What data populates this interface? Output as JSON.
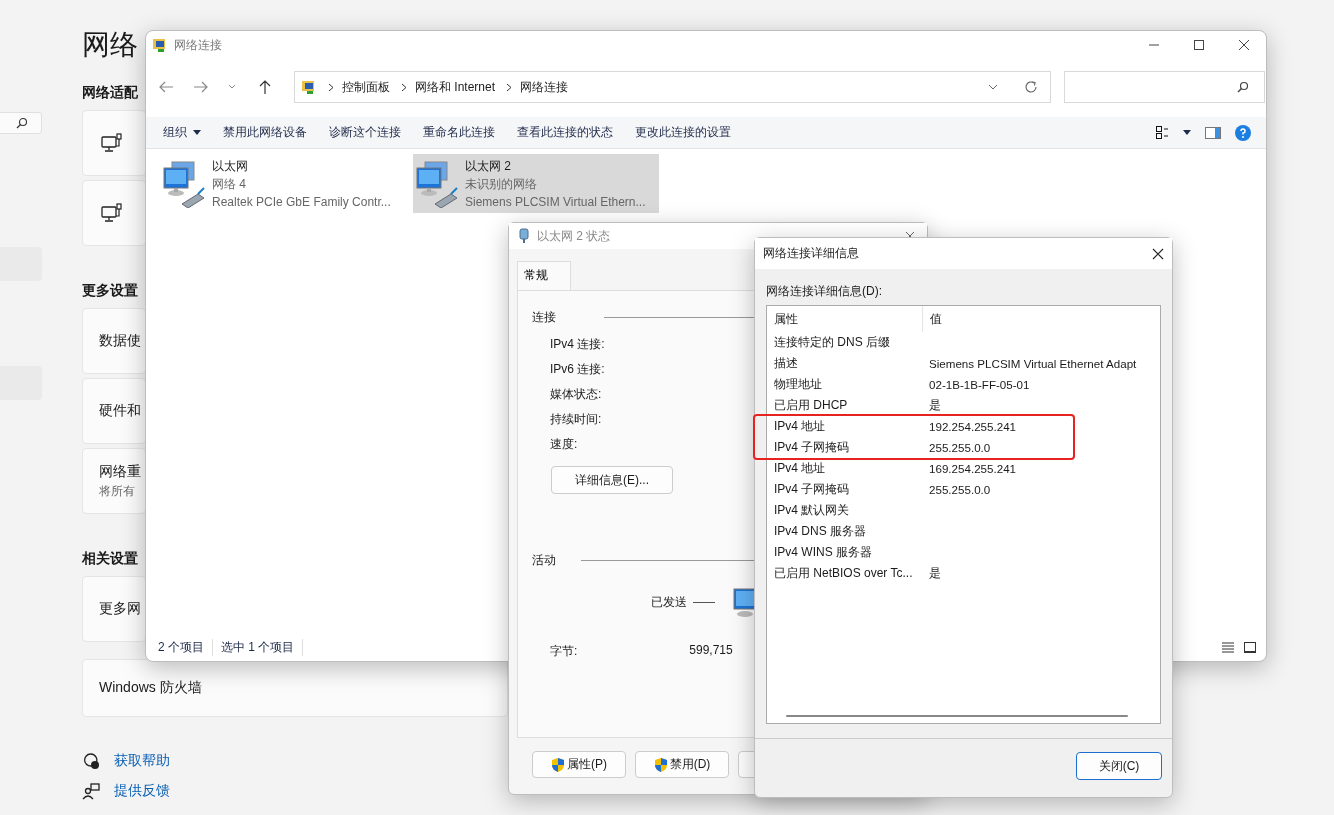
{
  "settings": {
    "title": "网络",
    "sections": [
      {
        "heading": "网络适配",
        "cards": [
          {
            "kind": "adapter"
          },
          {
            "kind": "adapter"
          }
        ]
      },
      {
        "heading": "更多设置",
        "cards": [
          {
            "kind": "link",
            "title": "数据使"
          },
          {
            "kind": "link",
            "title": "硬件和"
          },
          {
            "kind": "link",
            "title": "网络重",
            "subtitle": "将所有"
          }
        ]
      },
      {
        "heading": "相关设置",
        "cards": [
          {
            "kind": "link",
            "title": "更多网"
          },
          {
            "kind": "link",
            "title": "Windows 防火墙"
          }
        ]
      }
    ],
    "help_links": [
      {
        "kind": "help",
        "label": "获取帮助"
      },
      {
        "kind": "feedback",
        "label": "提供反馈"
      }
    ]
  },
  "explorer": {
    "title": "网络连接",
    "breadcrumb": [
      "控制面板",
      "网络和 Internet",
      "网络连接"
    ],
    "toolbar": [
      {
        "kind": "menu",
        "label": "组织"
      },
      {
        "kind": "action",
        "label": "禁用此网络设备"
      },
      {
        "kind": "action",
        "label": "诊断这个连接"
      },
      {
        "kind": "action",
        "label": "重命名此连接"
      },
      {
        "kind": "action",
        "label": "查看此连接的状态"
      },
      {
        "kind": "action",
        "label": "更改此连接的设置"
      }
    ],
    "items": [
      {
        "name": "以太网",
        "network": "网络 4",
        "device": "Realtek PCIe GbE Family Contr...",
        "selected": false
      },
      {
        "name": "以太网 2",
        "network": "未识别的网络",
        "device": "Siemens PLCSIM Virtual Ethern...",
        "selected": true
      }
    ],
    "status": [
      "2 个项目",
      "选中 1 个项目"
    ]
  },
  "status_dialog": {
    "title": "以太网 2 状态",
    "tabs": [
      {
        "label": "常规",
        "selected": true
      }
    ],
    "connection_heading": "连接",
    "labels": [
      "IPv4 连接:",
      "IPv6 连接:",
      "媒体状态:",
      "持续时间:",
      "速度:"
    ],
    "details_button": "详细信息(E)...",
    "activity_heading": "活动",
    "sent_label": "已发送",
    "bytes_label": "字节:",
    "bytes_sent": "599,715",
    "buttons": [
      {
        "label": "属性(P)"
      },
      {
        "label": "禁用(D)"
      }
    ]
  },
  "details_dialog": {
    "title": "网络连接详细信息",
    "list_label": "网络连接详细信息(D):",
    "columns": [
      "属性",
      "值"
    ],
    "rows": [
      {
        "property": "连接特定的 DNS 后缀",
        "highlighted": false
      },
      {
        "property": "描述",
        "value": "Siemens PLCSIM Virtual Ethernet Adapt",
        "highlighted": false
      },
      {
        "property": "物理地址",
        "value": "02-1B-1B-FF-05-01",
        "highlighted": false
      },
      {
        "property": "已启用 DHCP",
        "value": "是",
        "highlighted": false
      },
      {
        "property": "IPv4 地址",
        "value": "192.254.255.241",
        "highlighted": true
      },
      {
        "property": "IPv4 子网掩码",
        "value": "255.255.0.0",
        "highlighted": true
      },
      {
        "property": "IPv4 地址",
        "value": "169.254.255.241",
        "highlighted": false
      },
      {
        "property": "IPv4 子网掩码",
        "value": "255.255.0.0",
        "highlighted": false
      },
      {
        "property": "IPv4 默认网关",
        "highlighted": false
      },
      {
        "property": "IPv4 DNS 服务器",
        "highlighted": false
      },
      {
        "property": "IPv4 WINS 服务器",
        "highlighted": false
      },
      {
        "property": "已启用 NetBIOS over Tc...",
        "value": "是",
        "highlighted": false
      }
    ],
    "close_button": "关闭(C)"
  }
}
